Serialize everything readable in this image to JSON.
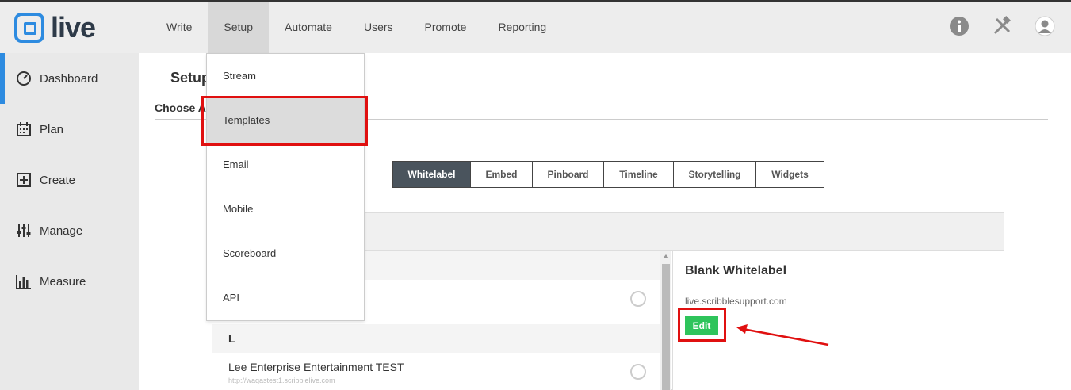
{
  "app": {
    "logo_text": "live",
    "brand_color": "#2d8be0"
  },
  "nav": {
    "items": [
      {
        "label": "Write"
      },
      {
        "label": "Setup",
        "active": true
      },
      {
        "label": "Automate"
      },
      {
        "label": "Users"
      },
      {
        "label": "Promote"
      },
      {
        "label": "Reporting"
      }
    ]
  },
  "top_icons": [
    "info-icon",
    "tools-icon",
    "user-avatar-icon"
  ],
  "sidebar": {
    "items": [
      {
        "label": "Dashboard",
        "icon": "gauge-icon",
        "active": true
      },
      {
        "label": "Plan",
        "icon": "calendar-icon"
      },
      {
        "label": "Create",
        "icon": "plus-square-icon"
      },
      {
        "label": "Manage",
        "icon": "sliders-icon"
      },
      {
        "label": "Measure",
        "icon": "bar-chart-icon"
      }
    ]
  },
  "setup_menu": {
    "items": [
      {
        "label": "Stream"
      },
      {
        "label": "Templates",
        "active": true
      },
      {
        "label": "Email"
      },
      {
        "label": "Mobile"
      },
      {
        "label": "Scoreboard"
      },
      {
        "label": "API"
      }
    ]
  },
  "main": {
    "title": "Setup",
    "subtitle": "Choose A",
    "tabs": [
      {
        "label": "Whitelabel",
        "active": true
      },
      {
        "label": "Embed"
      },
      {
        "label": "Pinboard"
      },
      {
        "label": "Timeline"
      },
      {
        "label": "Storytelling"
      },
      {
        "label": "Widgets"
      }
    ],
    "list": {
      "group_l": "L",
      "item_name": "Lee Enterprise Entertainment TEST",
      "item_url": "http://waqastest1.scribblelive.com"
    },
    "detail": {
      "title": "Blank Whitelabel",
      "url": "live.scribblesupport.com",
      "edit_label": "Edit"
    }
  },
  "colors": {
    "highlight": "#e01010",
    "edit_button": "#2ec45b",
    "active_tab": "#4a545d"
  }
}
